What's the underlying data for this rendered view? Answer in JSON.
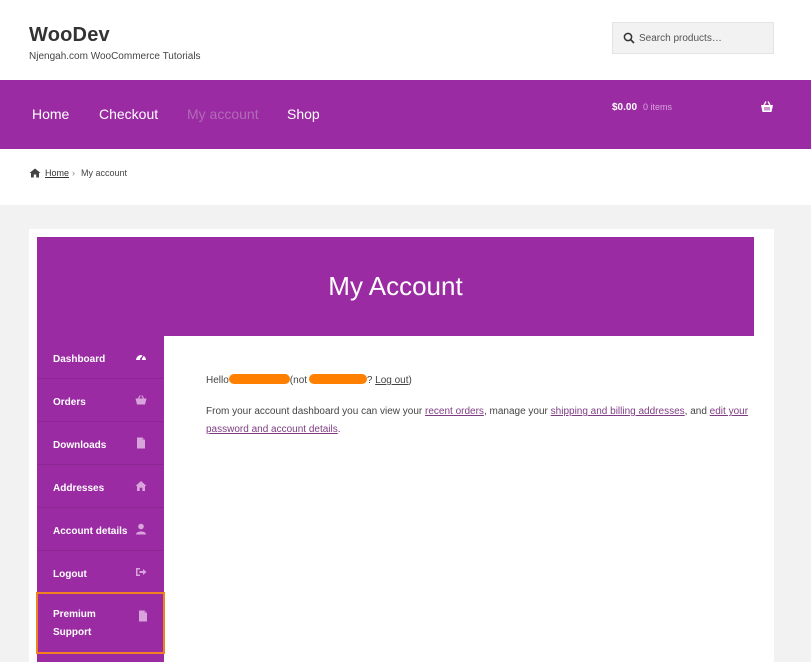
{
  "site": {
    "title": "WooDev",
    "tagline": "Njengah.com WooCommerce Tutorials"
  },
  "search": {
    "placeholder": "Search products…",
    "value": ""
  },
  "nav": {
    "items": [
      {
        "label": "Home",
        "current": false
      },
      {
        "label": "Checkout",
        "current": false
      },
      {
        "label": "My account",
        "current": true
      },
      {
        "label": "Shop",
        "current": false
      }
    ],
    "cart_total": "$0.00",
    "cart_count": "0 items"
  },
  "breadcrumb": {
    "home": "Home",
    "separator": "›",
    "current": "My account"
  },
  "page": {
    "title": "My Account"
  },
  "account_nav": {
    "items": [
      {
        "label": "Dashboard",
        "icon": "dashboard-icon"
      },
      {
        "label": "Orders",
        "icon": "basket-icon"
      },
      {
        "label": "Downloads",
        "icon": "file-icon"
      },
      {
        "label": "Addresses",
        "icon": "home-icon"
      },
      {
        "label": "Account details",
        "icon": "user-icon"
      },
      {
        "label": "Logout",
        "icon": "sign-out-icon"
      },
      {
        "label": "Premium Support",
        "icon": "file-icon",
        "highlighted": true
      }
    ]
  },
  "dashboard": {
    "hello": "Hello",
    "not_prefix": "(not",
    "logout_q": "?",
    "logout_link": "Log out",
    "close_paren": ")",
    "p2_a": "From your account dashboard you can view your",
    "recent_orders": "recent orders",
    "p2_b": ", manage your",
    "addresses_link": "shipping and billing addresses",
    "p2_c": ", and",
    "password_link": "edit your password and account details",
    "p2_d": "."
  },
  "colors": {
    "brand_purple": "#9b2ba3",
    "highlight_orange": "#f08020",
    "redaction": "#ff8000"
  }
}
